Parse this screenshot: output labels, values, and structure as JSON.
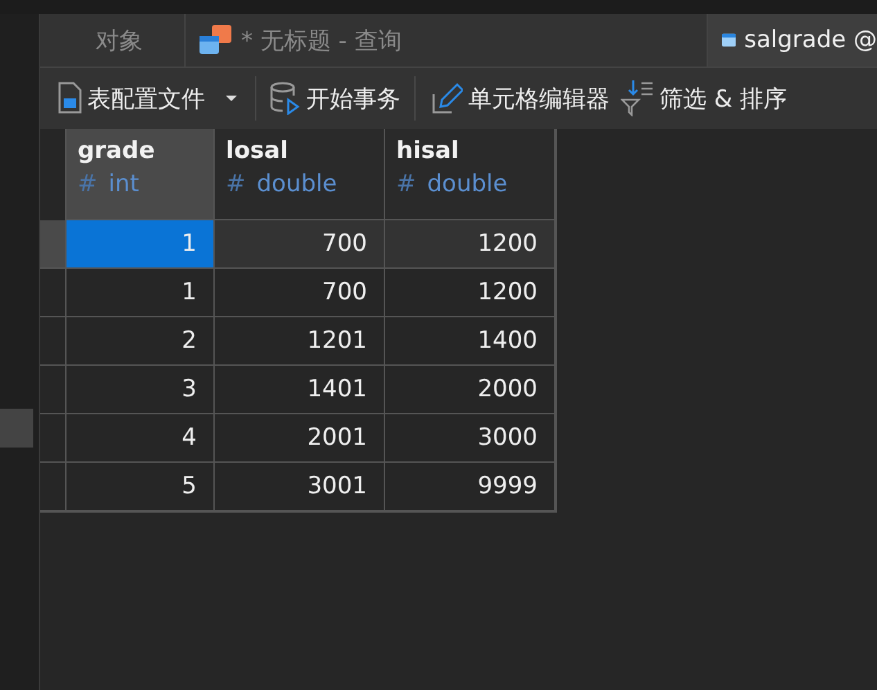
{
  "tabs": [
    {
      "label": "对象",
      "kind": "plain",
      "selected": false
    },
    {
      "label": "* 无标题 - 查询",
      "kind": "query",
      "selected": false
    },
    {
      "label": "salgrade @",
      "kind": "table",
      "selected": true
    }
  ],
  "toolbar": [
    {
      "label": "表配置文件",
      "kind": "file",
      "dropdown": true
    },
    {
      "label": "开始事务",
      "kind": "database",
      "dropdown": false
    },
    {
      "label": "单元格编辑器",
      "kind": "pencil",
      "dropdown": false
    },
    {
      "label": "筛选 & 排序",
      "kind": "filter",
      "dropdown": false
    }
  ],
  "table": {
    "columns": [
      {
        "name": "grade",
        "type_mark": "#",
        "type": "int",
        "selected": true
      },
      {
        "name": "losal",
        "type_mark": "#",
        "type": "double",
        "selected": false
      },
      {
        "name": "hisal",
        "type_mark": "#",
        "type": "double",
        "selected": false
      }
    ],
    "rows": [
      {
        "selected": true,
        "cells": [
          "1",
          "700",
          "1200"
        ]
      },
      {
        "selected": false,
        "cells": [
          "1",
          "700",
          "1200"
        ]
      },
      {
        "selected": false,
        "cells": [
          "2",
          "1201",
          "1400"
        ]
      },
      {
        "selected": false,
        "cells": [
          "3",
          "1401",
          "2000"
        ]
      },
      {
        "selected": false,
        "cells": [
          "4",
          "2001",
          "3000"
        ]
      },
      {
        "selected": false,
        "cells": [
          "5",
          "3001",
          "9999"
        ]
      }
    ]
  }
}
